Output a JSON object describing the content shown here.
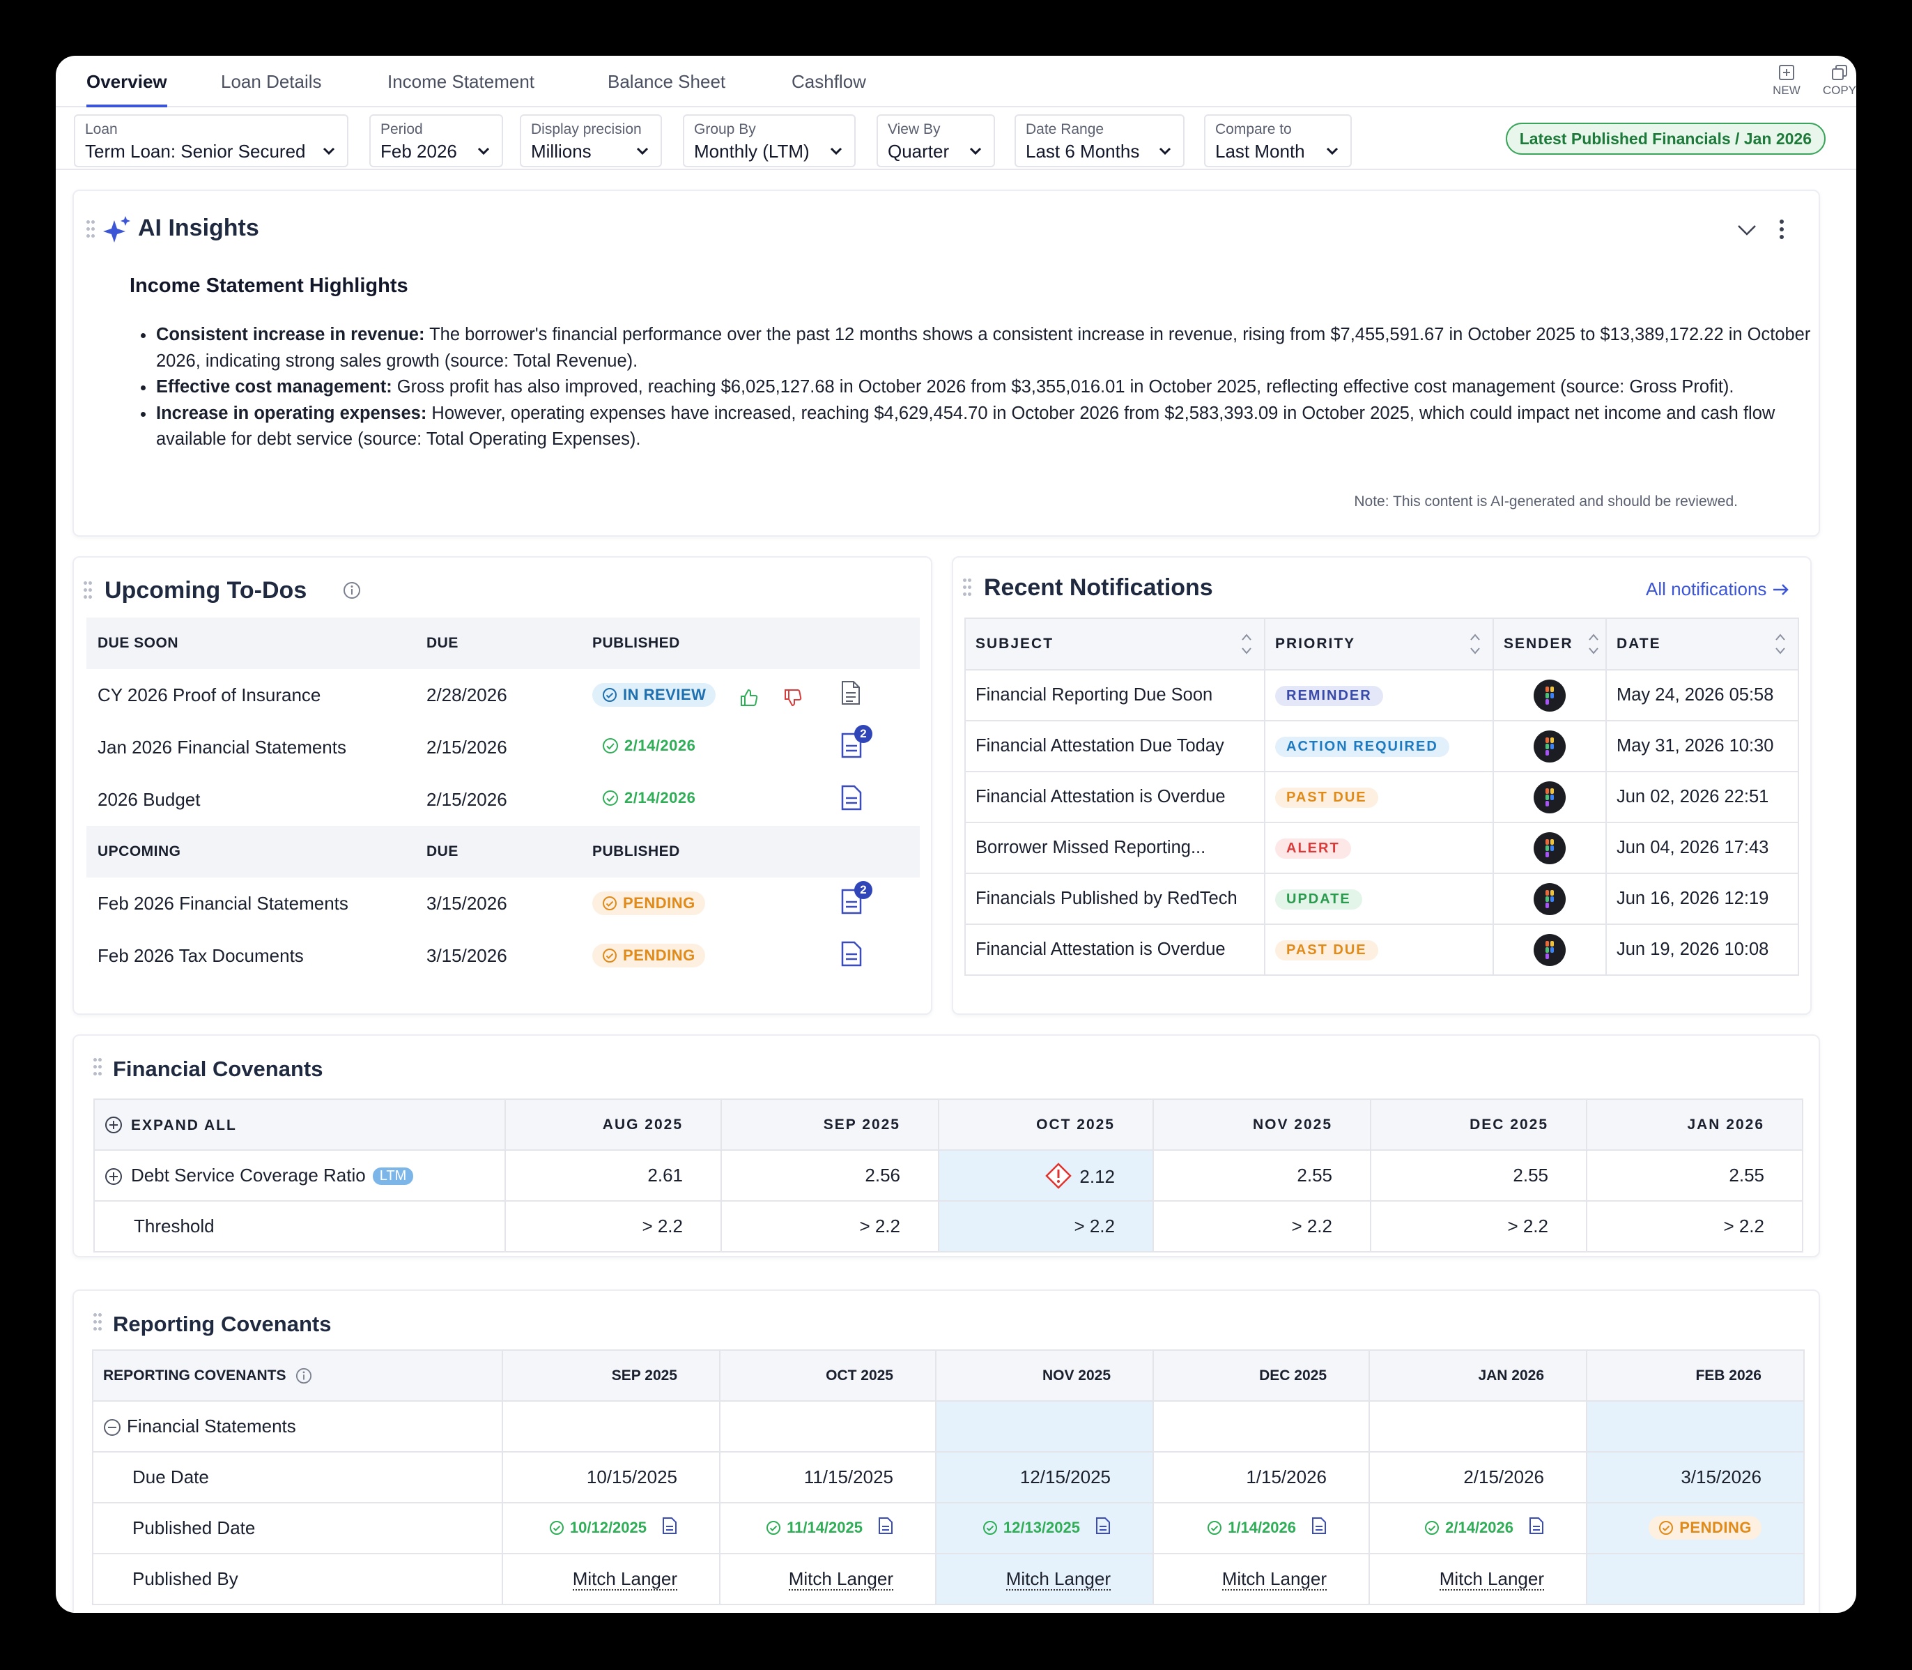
{
  "tabs": [
    {
      "label": "Overview",
      "active": true
    },
    {
      "label": "Loan Details"
    },
    {
      "label": "Income Statement"
    },
    {
      "label": "Balance Sheet"
    },
    {
      "label": "Cashflow"
    }
  ],
  "toolbar": {
    "new_label": "NEW",
    "copy_label": "COPY"
  },
  "filters": [
    {
      "label": "Loan",
      "value": "Term Loan: Senior Secured"
    },
    {
      "label": "Period",
      "value": "Feb 2026"
    },
    {
      "label": "Display precision",
      "value": "Millions"
    },
    {
      "label": "Group By",
      "value": "Monthly (LTM)"
    },
    {
      "label": "View By",
      "value": "Quarter"
    },
    {
      "label": "Date Range",
      "value": "Last 6 Months"
    },
    {
      "label": "Compare to",
      "value": "Last Month"
    }
  ],
  "published_badge": "Latest Published Financials / Jan 2026",
  "ai": {
    "title": "AI Insights",
    "heading": "Income Statement Highlights",
    "bullets": [
      {
        "bold": "Consistent increase in revenue:",
        "text": " The borrower's financial performance over the past 12 months shows a consistent increase in revenue, rising from $7,455,591.67 in October 2025 to $13,389,172.22 in October 2026, indicating strong sales growth (source: Total Revenue)."
      },
      {
        "bold": "Effective cost management:",
        "text": " Gross profit has also improved, reaching $6,025,127.68 in October 2026 from $3,355,016.01 in October 2025, reflecting effective cost management (source: Gross Profit)."
      },
      {
        "bold": "Increase in operating expenses:",
        "text": " However, operating expenses have increased, reaching $4,629,454.70 in October 2026 from $2,583,393.09 in October 2025, which could impact net income and cash flow available for debt service (source: Total Operating Expenses)."
      }
    ],
    "note": "Note: This content is AI-generated and should be reviewed."
  },
  "todos": {
    "title": "Upcoming To-Dos",
    "soon_header": {
      "c1": "DUE SOON",
      "c2": "DUE",
      "c3": "PUBLISHED"
    },
    "soon": [
      {
        "name": "CY 2026 Proof of Insurance",
        "due": "2/28/2026",
        "status": "IN REVIEW",
        "kind": "review"
      },
      {
        "name": "Jan 2026 Financial Statements",
        "due": "2/15/2026",
        "status": "2/14/2026",
        "kind": "done",
        "count": "2"
      },
      {
        "name": "2026 Budget",
        "due": "2/15/2026",
        "status": "2/14/2026",
        "kind": "done"
      }
    ],
    "upcoming_header": {
      "c1": "UPCOMING",
      "c2": "DUE",
      "c3": "PUBLISHED"
    },
    "upcoming": [
      {
        "name": "Feb 2026 Financial Statements",
        "due": "3/15/2026",
        "status": "PENDING",
        "kind": "pending",
        "count": "2"
      },
      {
        "name": "Feb 2026 Tax Documents",
        "due": "3/15/2026",
        "status": "PENDING",
        "kind": "pending"
      }
    ]
  },
  "notifications": {
    "title": "Recent Notifications",
    "all_link": "All notifications",
    "headers": [
      "SUBJECT",
      "PRIORITY",
      "SENDER",
      "DATE"
    ],
    "rows": [
      {
        "subject": "Financial Reporting Due Soon",
        "priority": "REMINDER",
        "bg": "#e3e7f7",
        "fg": "#3a4aa8",
        "date": "May 24, 2026 05:58"
      },
      {
        "subject": "Financial Attestation Due Today",
        "priority": "ACTION REQUIRED",
        "bg": "#e1f0fb",
        "fg": "#1d7ac0",
        "date": "May 31, 2026 10:30"
      },
      {
        "subject": "Financial Attestation is Overdue",
        "priority": "PAST DUE",
        "bg": "#fdf0e0",
        "fg": "#e08a1a",
        "date": "Jun 02, 2026 22:51"
      },
      {
        "subject": "Borrower Missed Reporting...",
        "priority": "ALERT",
        "bg": "#fde7e7",
        "fg": "#d93a3a",
        "date": "Jun 04, 2026 17:43"
      },
      {
        "subject": "Financials Published by RedTech",
        "priority": "UPDATE",
        "bg": "#e3f5e8",
        "fg": "#2a9a4e",
        "date": "Jun 16, 2026 12:19"
      },
      {
        "subject": "Financial Attestation is Overdue",
        "priority": "PAST DUE",
        "bg": "#fdf0e0",
        "fg": "#e08a1a",
        "date": "Jun 19, 2026 10:08"
      }
    ]
  },
  "fin_cov": {
    "title": "Financial Covenants",
    "expand_all": "EXPAND ALL",
    "months": [
      "AUG 2025",
      "SEP 2025",
      "OCT 2025",
      "NOV 2025",
      "DEC 2025",
      "JAN 2026"
    ],
    "metric": {
      "name": "Debt Service Coverage Ratio",
      "tag": "LTM",
      "values": [
        "2.61",
        "2.56",
        "2.12",
        "2.55",
        "2.55",
        "2.55"
      ]
    },
    "threshold": {
      "name": "Threshold",
      "values": [
        "> 2.2",
        "> 2.2",
        "> 2.2",
        "> 2.2",
        "> 2.2",
        "> 2.2"
      ]
    }
  },
  "rep_cov": {
    "title": "Reporting Covenants",
    "header": "REPORTING COVENANTS",
    "months": [
      "SEP 2025",
      "OCT 2025",
      "NOV 2025",
      "DEC 2025",
      "JAN 2026",
      "FEB 2026"
    ],
    "group": "Financial Statements",
    "due_label": "Due Date",
    "due": [
      "10/15/2025",
      "11/15/2025",
      "12/15/2025",
      "1/15/2026",
      "2/15/2026",
      "3/15/2026"
    ],
    "pub_label": "Published Date",
    "published": [
      "10/12/2025",
      "11/14/2025",
      "12/13/2025",
      "1/14/2026",
      "2/14/2026",
      "PENDING"
    ],
    "by_label": "Published By",
    "by": [
      "Mitch Langer",
      "Mitch Langer",
      "Mitch Langer",
      "Mitch Langer",
      "Mitch Langer",
      ""
    ]
  }
}
